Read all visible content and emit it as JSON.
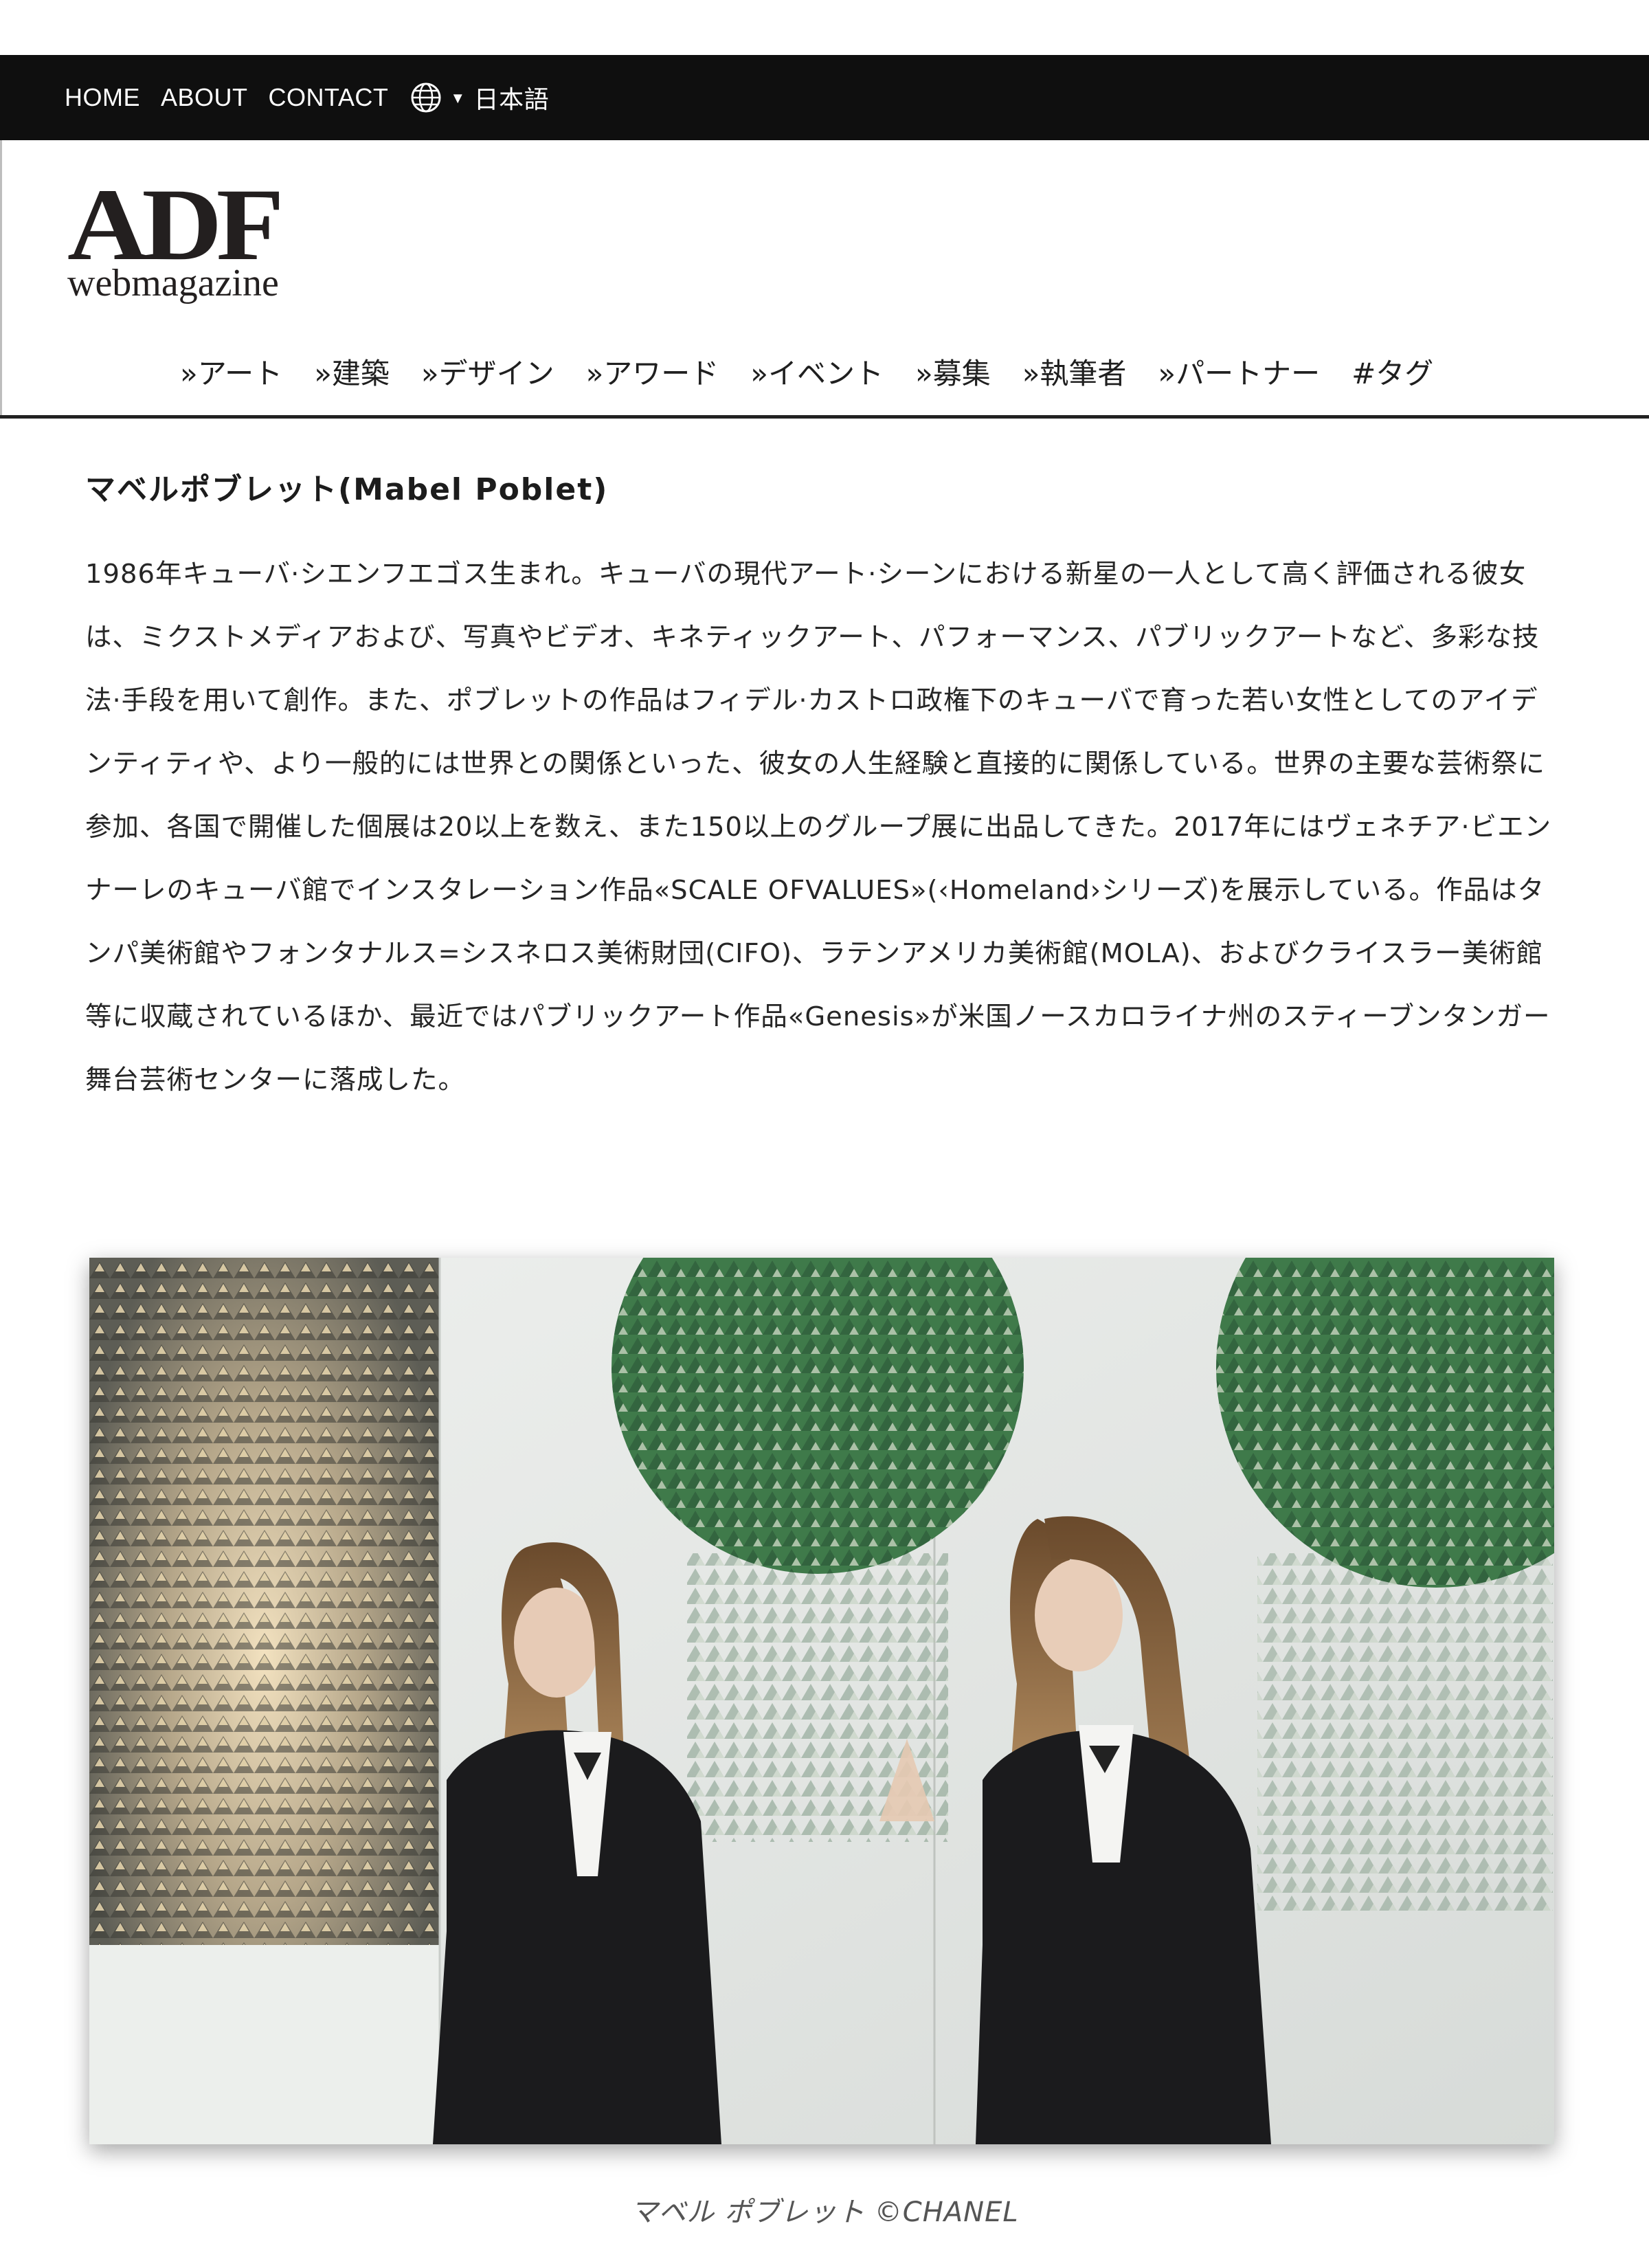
{
  "topbar": {
    "nav": [
      "HOME",
      "ABOUT",
      "CONTACT"
    ],
    "language": "日本語",
    "globe_icon": "globe-icon",
    "caret_icon": "caret-down-icon"
  },
  "logo": {
    "main": "ADF",
    "sub": "webmagazine"
  },
  "categories": [
    "»アート",
    "»建築",
    "»デザイン",
    "»アワード",
    "»イベント",
    "»募集",
    "»執筆者",
    "»パートナー",
    "#タグ"
  ],
  "article": {
    "title": "マベルポブレット(Mabel Poblet)",
    "body": "1986年キューバ·シエンフエゴス生まれ。キューバの現代アート·シーンにおける新星の一人として高く評価される彼女は、ミクストメディアおよび、写真やビデオ、キネティックアート、パフォーマンス、パブリックアートなど、多彩な技法·手段を用いて創作。また、ポブレットの作品はフィデル·カストロ政権下のキューバで育った若い女性としてのアイデンティティや、より一般的には世界との関係といった、彼女の人生経験と直接的に関係している。世界の主要な芸術祭に参加、各国で開催した個展は20以上を数え、また150以上のグループ展に出品してきた。2017年にはヴェネチア·ビエンナーレのキューバ館でインスタレーション作品«SCALE OFVALUES»(‹Homeland›シリーズ)を展示している。作品はタンパ美術館やフォンタナルス=シスネロス美術財団(CIFO)、ラテンアメリカ美術館(MOLA)、およびクライスラー美術館等に収蔵されているほか、最近ではパブリックアート作品«Genesis»が米国ノースカロライナ州のスティーブンタンガー舞台芸術センターに落成した。",
    "caption": "マベル ポブレット ©CHANEL"
  },
  "colors": {
    "topbar_bg": "#0f0f0f",
    "text": "#262626",
    "caption": "#555555"
  }
}
